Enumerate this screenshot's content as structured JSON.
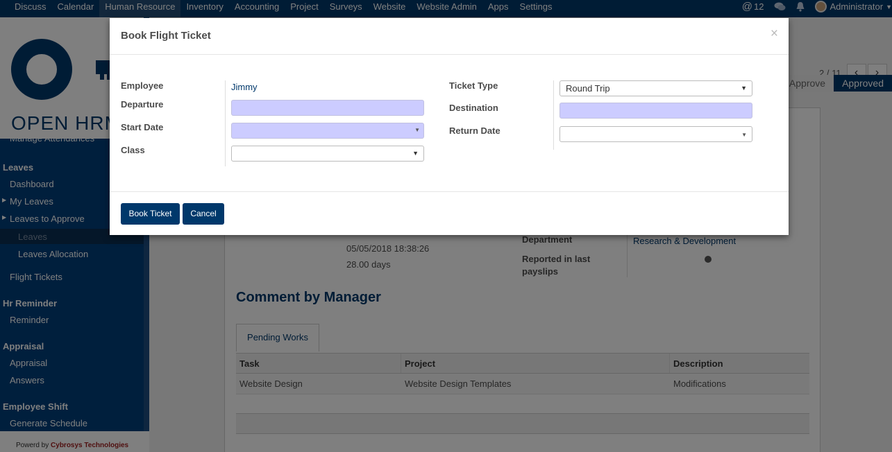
{
  "topnav": {
    "menu": [
      "Discuss",
      "Calendar",
      "Human Resource",
      "Inventory",
      "Accounting",
      "Project",
      "Surveys",
      "Website",
      "Website Admin",
      "Apps",
      "Settings"
    ],
    "active_index": 2,
    "mentions_count": "12",
    "user": "Administrator"
  },
  "sidebar": {
    "logo_text": "OPEN HRM",
    "cut_item": "Manage Attendances",
    "sections": [
      {
        "title": "Leaves",
        "items": [
          "Dashboard",
          "My Leaves",
          "Leaves to Approve"
        ],
        "subitems": [
          "Leaves",
          "Leaves Allocation"
        ],
        "after": "Flight Tickets"
      },
      {
        "title": "Hr Reminder",
        "items": [
          "Reminder"
        ]
      },
      {
        "title": "Appraisal",
        "items": [
          "Appraisal",
          "Answers"
        ]
      },
      {
        "title": "Employee Shift",
        "items": [
          "Generate Schedule"
        ]
      }
    ],
    "footer_prefix": "Powerd by",
    "footer_brand": "Cybrosys Technologies"
  },
  "record": {
    "pager": "2 / 11",
    "statuses": [
      "Approve",
      "Approved"
    ],
    "date_value": "05/05/2018 18:38:26",
    "days_value": "28.00 days",
    "department_label": "Department",
    "department_value": "Research & Development",
    "payslip_label": "Reported in last payslips",
    "comment_heading": "Comment by Manager",
    "tab_label": "Pending Works",
    "table": {
      "headers": [
        "Task",
        "Project",
        "Description"
      ],
      "rows": [
        [
          "Website Design",
          "Website Design Templates",
          "Modifications"
        ]
      ]
    }
  },
  "modal": {
    "title": "Book Flight Ticket",
    "close_symbol": "×",
    "fields": {
      "employee_label": "Employee",
      "employee_value": "Jimmy",
      "departure_label": "Departure",
      "start_date_label": "Start Date",
      "class_label": "Class",
      "ticket_type_label": "Ticket Type",
      "ticket_type_value": "Round Trip",
      "destination_label": "Destination",
      "return_date_label": "Return Date"
    },
    "buttons": {
      "book": "Book Ticket",
      "cancel": "Cancel"
    }
  },
  "colors": {
    "brand": "#00386b",
    "required_field": "#ccccff"
  }
}
